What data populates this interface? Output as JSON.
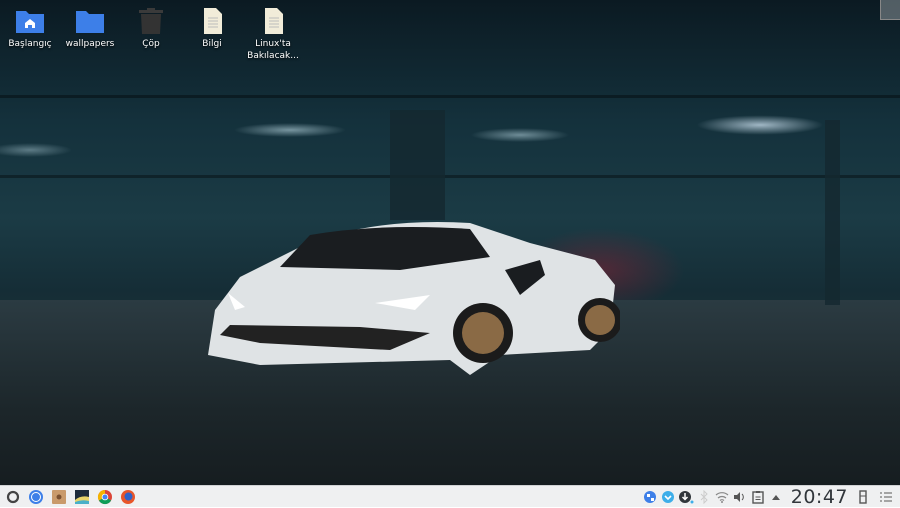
{
  "desktop": {
    "icons": [
      {
        "label": "Başlangıç",
        "icon": "home-folder-icon"
      },
      {
        "label": "wallpapers",
        "icon": "folder-icon"
      },
      {
        "label": "Çöp",
        "icon": "trash-icon"
      },
      {
        "label": "Bilgi",
        "icon": "text-file-icon"
      },
      {
        "label": "Linux'ta Bakılacak...",
        "icon": "text-file-icon"
      }
    ]
  },
  "panel": {
    "launchers": [
      "application-launcher",
      "browser-globe",
      "archive-manager",
      "image-viewer",
      "chrome",
      "firefox"
    ],
    "tray": [
      "network-globe",
      "update-notifier",
      "download",
      "bluetooth",
      "wifi",
      "volume",
      "clipboard",
      "expand-tray"
    ],
    "clock": "20:47"
  },
  "colors": {
    "folder": "#3d7fe8",
    "panel": "#eff0f1",
    "clock": "#31363b"
  }
}
